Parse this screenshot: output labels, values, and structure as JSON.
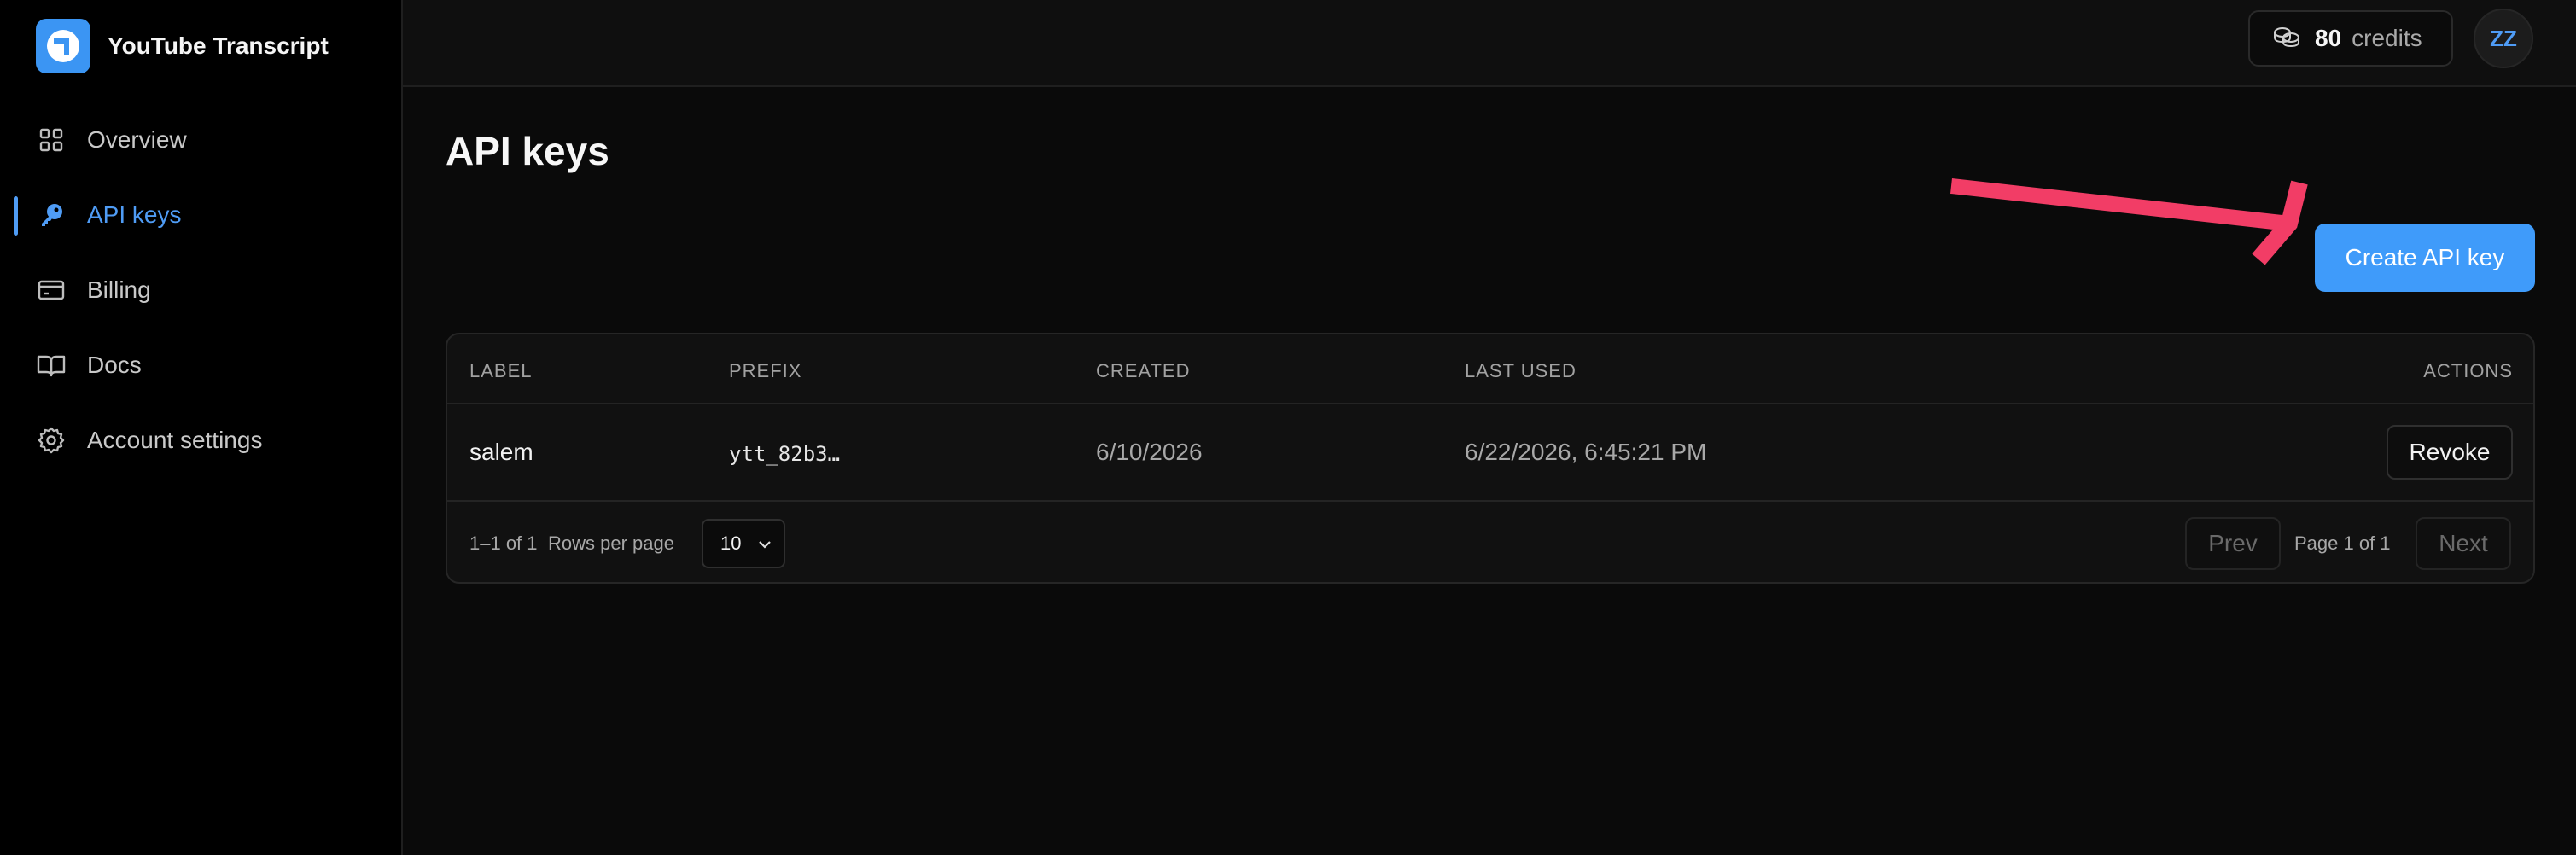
{
  "app": {
    "title": "YouTube Transcript"
  },
  "sidebar": {
    "items": [
      {
        "label": "Overview",
        "icon": "grid-icon",
        "active": false
      },
      {
        "label": "API keys",
        "icon": "key-icon",
        "active": true
      },
      {
        "label": "Billing",
        "icon": "credit-card-icon",
        "active": false
      },
      {
        "label": "Docs",
        "icon": "book-icon",
        "active": false
      },
      {
        "label": "Account settings",
        "icon": "gear-icon",
        "active": false
      }
    ]
  },
  "header": {
    "credits_value": "80",
    "credits_label": "credits",
    "avatar_initials": "ZZ"
  },
  "main": {
    "title": "API keys",
    "create_button": "Create API key",
    "table": {
      "columns": [
        "LABEL",
        "PREFIX",
        "CREATED",
        "LAST USED",
        "ACTIONS"
      ],
      "rows": [
        {
          "label": "salem",
          "prefix": "ytt_82b3…",
          "created": "6/10/2026",
          "last_used": "6/22/2026, 6:45:21 PM",
          "action": "Revoke"
        }
      ]
    },
    "pagination": {
      "range": "1–1 of 1",
      "rows_per_page_label": "Rows per page",
      "rows_per_page_value": "10",
      "prev": "Prev",
      "page_info": "Page 1 of 1",
      "next": "Next"
    }
  },
  "colors": {
    "accent": "#3f9bfa",
    "annotation_arrow": "#f23d66",
    "background": "#0a0a0a"
  }
}
